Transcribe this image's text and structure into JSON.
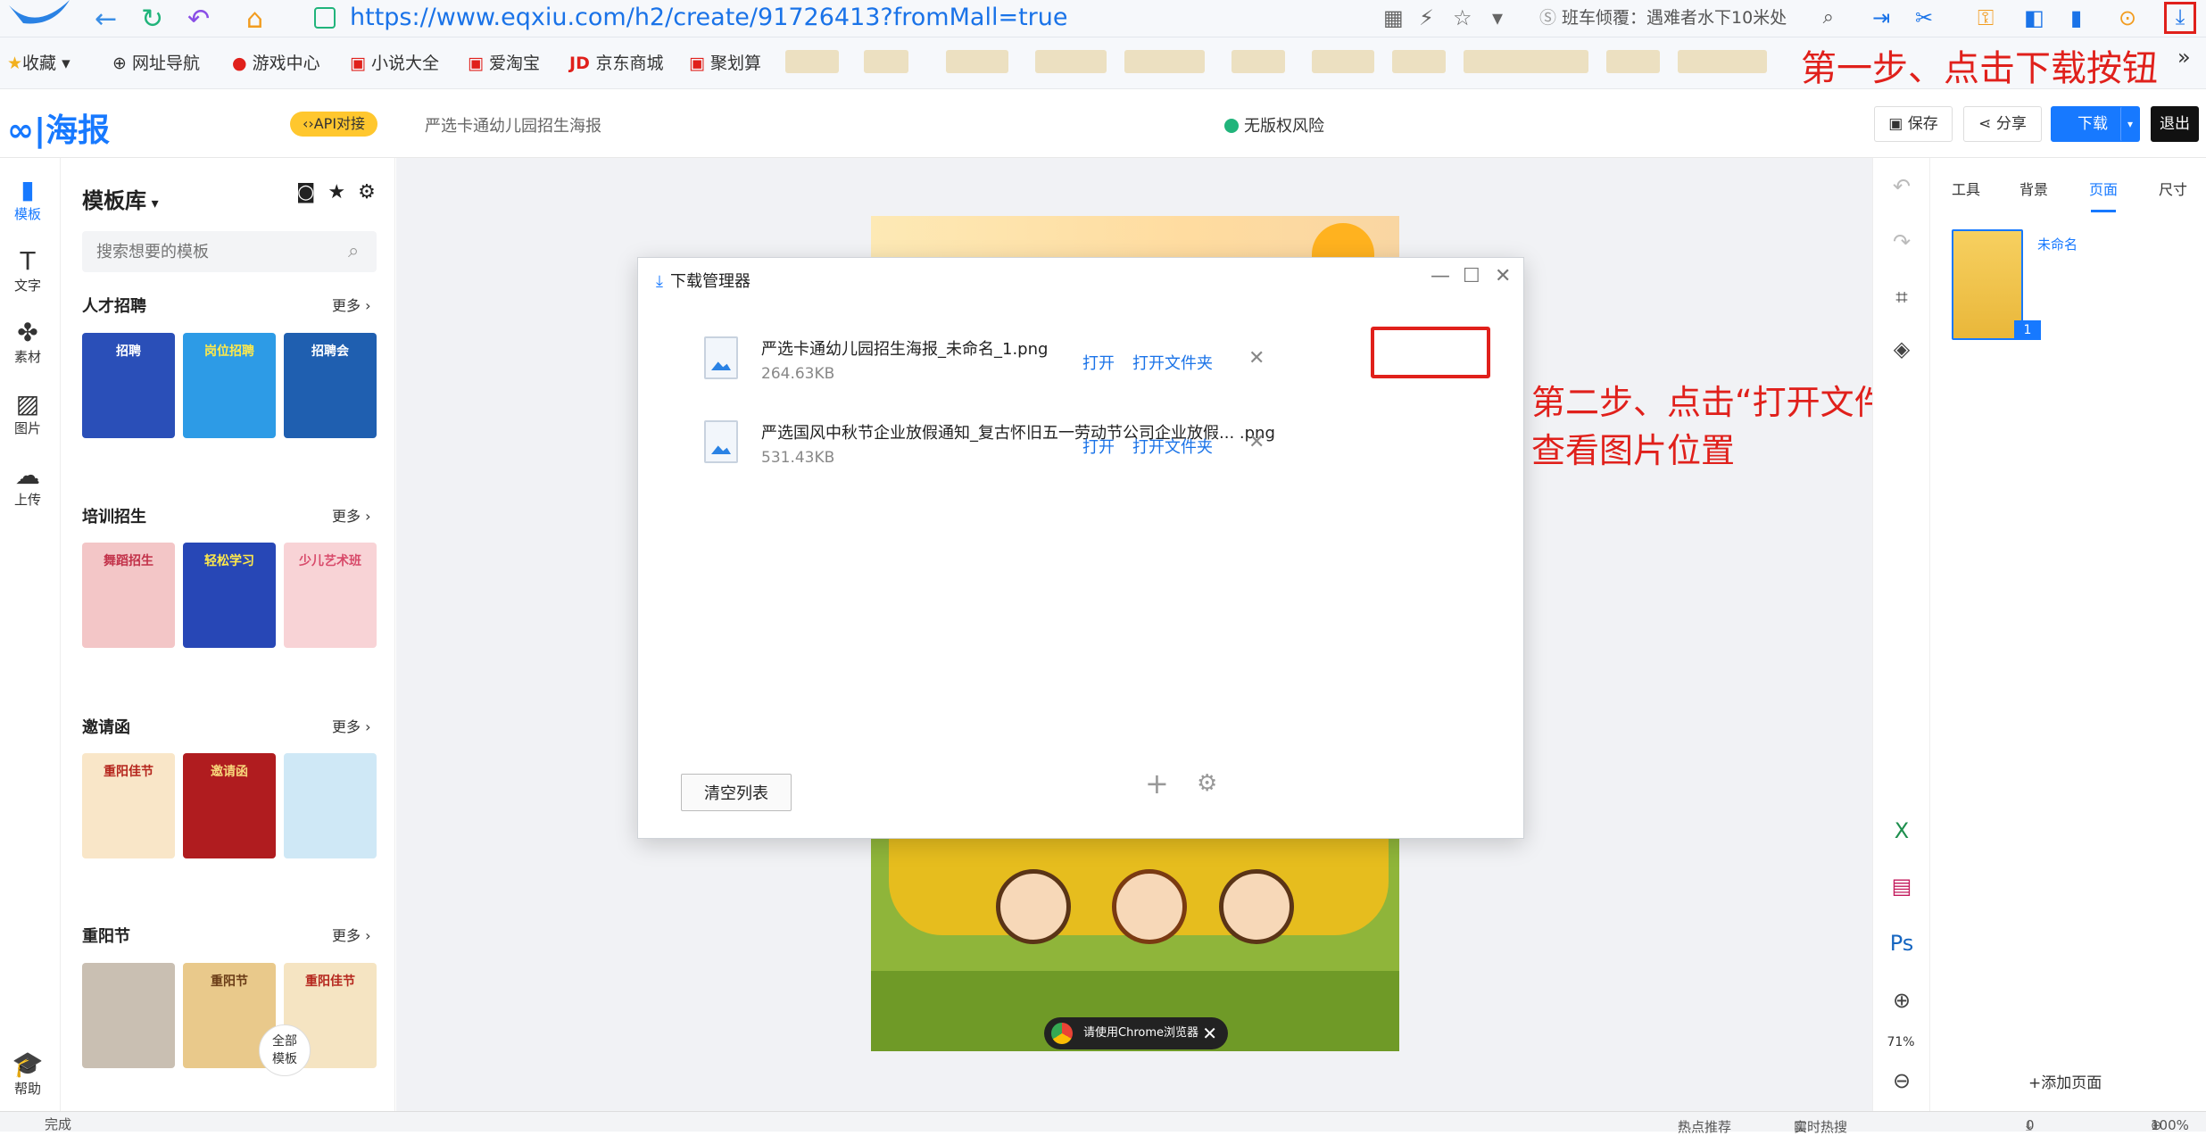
{
  "browser": {
    "url": "https://www.eqxiu.com/h2/create/91726413?fromMall=true",
    "search_text": "班车倾覆：遇难者水下10米处",
    "bookmarks": [
      "收藏",
      "网址导航",
      "游戏中心",
      "小说大全",
      "爱淘宝",
      "京东商城",
      "聚划算"
    ]
  },
  "annotations": {
    "step1": "第一步、点击下载按钮",
    "step2_line1": "第二步、点击“打开文件夹”按钮",
    "step2_line2": "查看图片位置"
  },
  "header": {
    "brand": "海报",
    "api_label": "API对接",
    "doc_title": "严选卡通幼儿园招生海报",
    "no_risk": "无版权风险",
    "save": "保存",
    "share": "分享",
    "download": "下载",
    "exit": "退出"
  },
  "rail": [
    "模板",
    "文字",
    "素材",
    "图片",
    "上传",
    "帮助"
  ],
  "templates": {
    "title": "模板库",
    "search_placeholder": "搜索想要的模板",
    "more": "更多",
    "view_all_1": "全部",
    "view_all_2": "模板",
    "categories": [
      {
        "name": "人才招聘",
        "thumbs": [
          "招聘",
          "岗位招聘",
          "招聘会"
        ]
      },
      {
        "name": "培训招生",
        "thumbs": [
          "舞蹈招生",
          "轻松学习",
          "少儿艺术班"
        ]
      },
      {
        "name": "邀请函",
        "thumbs": [
          "重阳佳节",
          "邀请函",
          ""
        ]
      },
      {
        "name": "重阳节",
        "thumbs": [
          "",
          "重阳节",
          "重阳佳节"
        ]
      }
    ]
  },
  "download_manager": {
    "title": "下载管理器",
    "items": [
      {
        "name": "严选卡通幼儿园招生海报_未命名_1.png",
        "size": "264.63KB",
        "open": "打开",
        "folder": "打开文件夹"
      },
      {
        "name": "严选国风中秋节企业放假通知_复古怀旧五一劳动节公司企业放假...  .png",
        "size": "531.43KB",
        "open": "打开",
        "folder": "打开文件夹"
      }
    ],
    "clear": "清空列表"
  },
  "chrome_tip": "请使用Chrome浏览器",
  "right_panel": {
    "tabs": [
      "工具",
      "背景",
      "页面",
      "尺寸"
    ],
    "page_name": "未命名",
    "page_number": "1",
    "add_page": "添加页面",
    "zoom": "71%"
  },
  "status": {
    "left": "完成",
    "hot": "热点推荐",
    "live": "实时热搜",
    "count": "0",
    "zoom": "100%"
  }
}
